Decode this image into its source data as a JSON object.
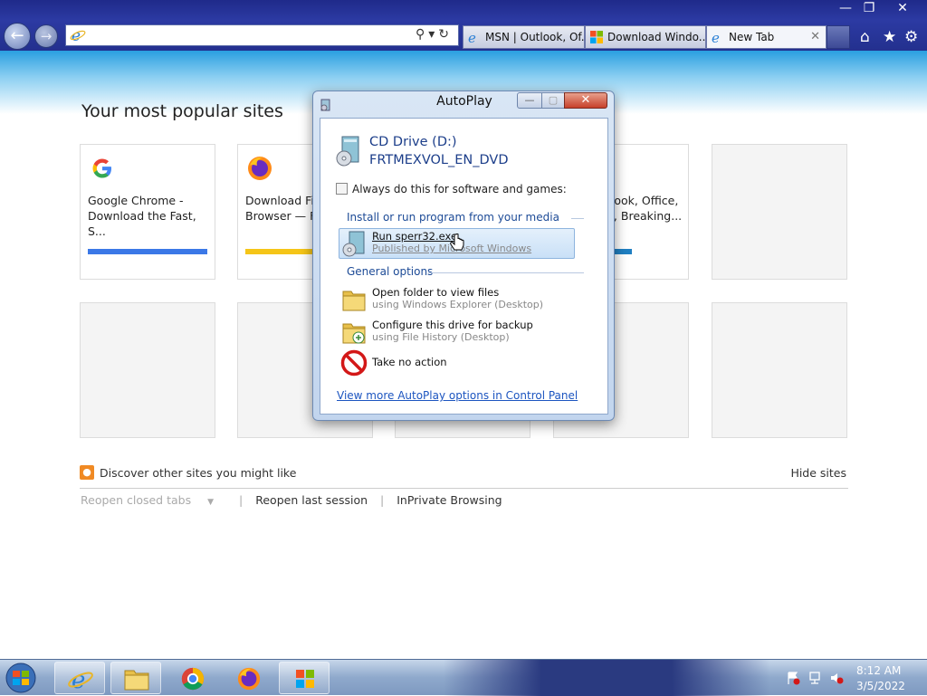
{
  "browser": {
    "tabs": [
      {
        "label": "MSN | Outlook, Of..."
      },
      {
        "label": "Download Windo..."
      },
      {
        "label": "New Tab"
      }
    ]
  },
  "content": {
    "popular_title": "Your most popular sites",
    "tiles": [
      {
        "line1": "Google Chrome -",
        "line2": "Download the Fast, S...",
        "bar_color": "#3b78e7"
      },
      {
        "line1": "Download Fi",
        "line2": "Browser — F",
        "bar_color": "#f5c518"
      },
      {
        "line1": "tlook, Office,",
        "line2": "g, Breaking...",
        "bar_color": "#1f7fc2"
      }
    ],
    "discover_text": "Discover other sites you might like",
    "hide_sites": "Hide sites",
    "links": {
      "reopen_closed": "Reopen closed tabs",
      "reopen_last": "Reopen last session",
      "inprivate": "InPrivate Browsing"
    }
  },
  "autoplay": {
    "title": "AutoPlay",
    "drive_line1": "CD Drive (D:)",
    "drive_line2": "FRTMEXVOL_EN_DVD",
    "always_label": "Always do this for software and games:",
    "section_install": "Install or run program from your media",
    "run_title": "Run sperr32.exe",
    "run_sub": "Published by Microsoft Windows",
    "section_general": "General options",
    "open_title": "Open folder to view files",
    "open_sub": "using Windows Explorer (Desktop)",
    "backup_title": "Configure this drive for backup",
    "backup_sub": "using File History (Desktop)",
    "noaction_title": "Take no action",
    "cp_link": "View more AutoPlay options in Control Panel"
  },
  "taskbar": {
    "time": "8:12 AM",
    "date": "3/5/2022"
  }
}
